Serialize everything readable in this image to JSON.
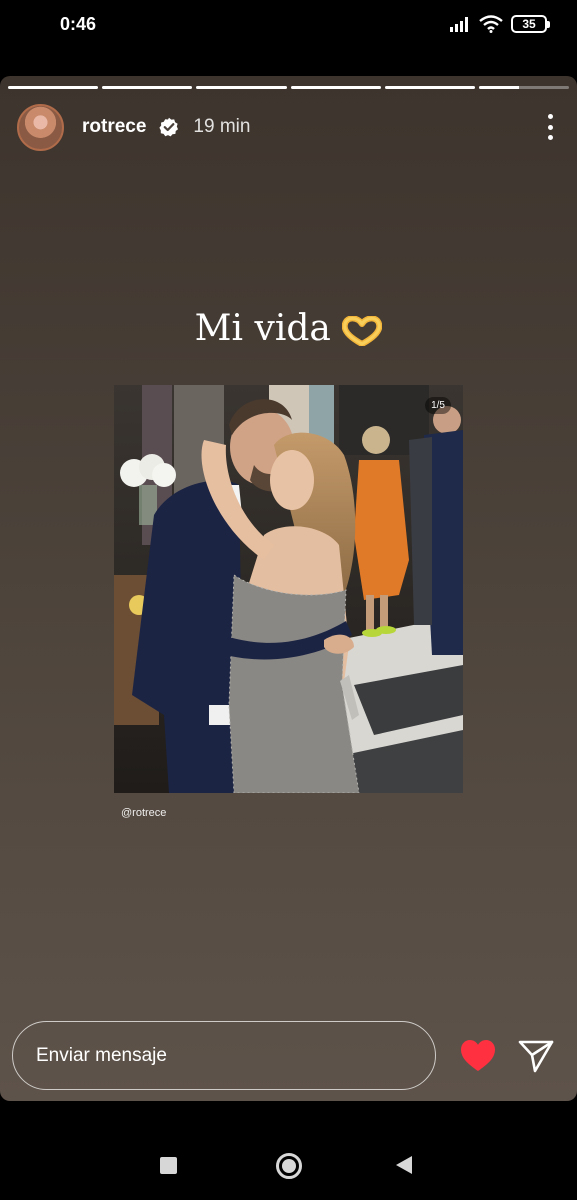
{
  "status_bar": {
    "time": "0:46",
    "battery": "35",
    "icons": [
      "signal-icon",
      "wifi-icon",
      "battery-icon"
    ]
  },
  "story": {
    "segments_total": 6,
    "current_segment": 6,
    "current_progress": 0.45,
    "username": "rotrece",
    "verified": true,
    "time_ago": "19 min",
    "caption": "Mi vida",
    "caption_emoji": "heart-hands",
    "post": {
      "counter": "1/5",
      "handle": "@rotrece"
    }
  },
  "reply": {
    "placeholder": "Enviar mensaje"
  },
  "colors": {
    "background_top": "#3d342d",
    "background_bottom": "#5e534a",
    "like": "#ff3040",
    "verified_badge": "#ffffff"
  },
  "nav_bar": {
    "icons": [
      "recents-icon",
      "home-icon",
      "back-icon"
    ]
  }
}
